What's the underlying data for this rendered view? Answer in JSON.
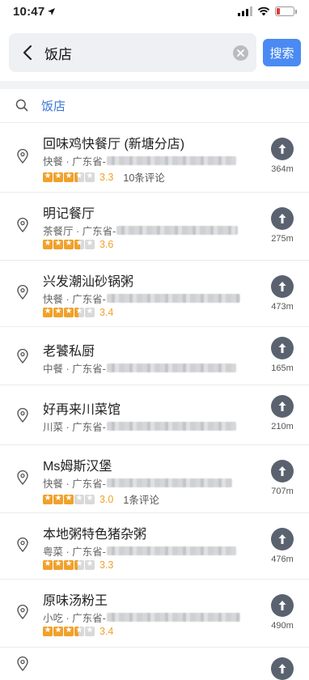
{
  "status": {
    "time": "10:47"
  },
  "search": {
    "query": "饭店",
    "button_label": "搜索"
  },
  "suggestion": {
    "text": "饭店"
  },
  "colors": {
    "accent": "#4a8af2",
    "rating": "#f0a12b",
    "link": "#3a76d6"
  },
  "results": [
    {
      "name": "回味鸡快餐厅 (新塘分店)",
      "category": "快餐 · 广东省-",
      "rating": 3.3,
      "score": "3.3",
      "reviews": "10条评论",
      "distance": "364m"
    },
    {
      "name": "明记餐厅",
      "category": "茶餐厅 · 广东省-",
      "rating": 3.6,
      "score": "3.6",
      "reviews": "",
      "distance": "275m"
    },
    {
      "name": "兴发潮汕砂锅粥",
      "category": "快餐 · 广东省-",
      "rating": 3.4,
      "score": "3.4",
      "reviews": "",
      "distance": "473m"
    },
    {
      "name": "老饕私厨",
      "category": "中餐 · 广东省-",
      "rating": null,
      "score": "",
      "reviews": "",
      "distance": "165m"
    },
    {
      "name": "好再来川菜馆",
      "category": "川菜 · 广东省-",
      "rating": null,
      "score": "",
      "reviews": "",
      "distance": "210m"
    },
    {
      "name": "Ms姆斯汉堡",
      "category": "快餐 · 广东省-",
      "rating": 3.0,
      "score": "3.0",
      "reviews": "1条评论",
      "distance": "707m"
    },
    {
      "name": "本地粥特色猪杂粥",
      "category": "粤菜 · 广东省-",
      "rating": 3.3,
      "score": "3.3",
      "reviews": "",
      "distance": "476m"
    },
    {
      "name": "原味汤粉王",
      "category": "小吃 · 广东省-",
      "rating": 3.4,
      "score": "3.4",
      "reviews": "",
      "distance": "490m"
    },
    {
      "name": "",
      "category": "",
      "rating": null,
      "score": "",
      "reviews": "",
      "distance": ""
    }
  ]
}
